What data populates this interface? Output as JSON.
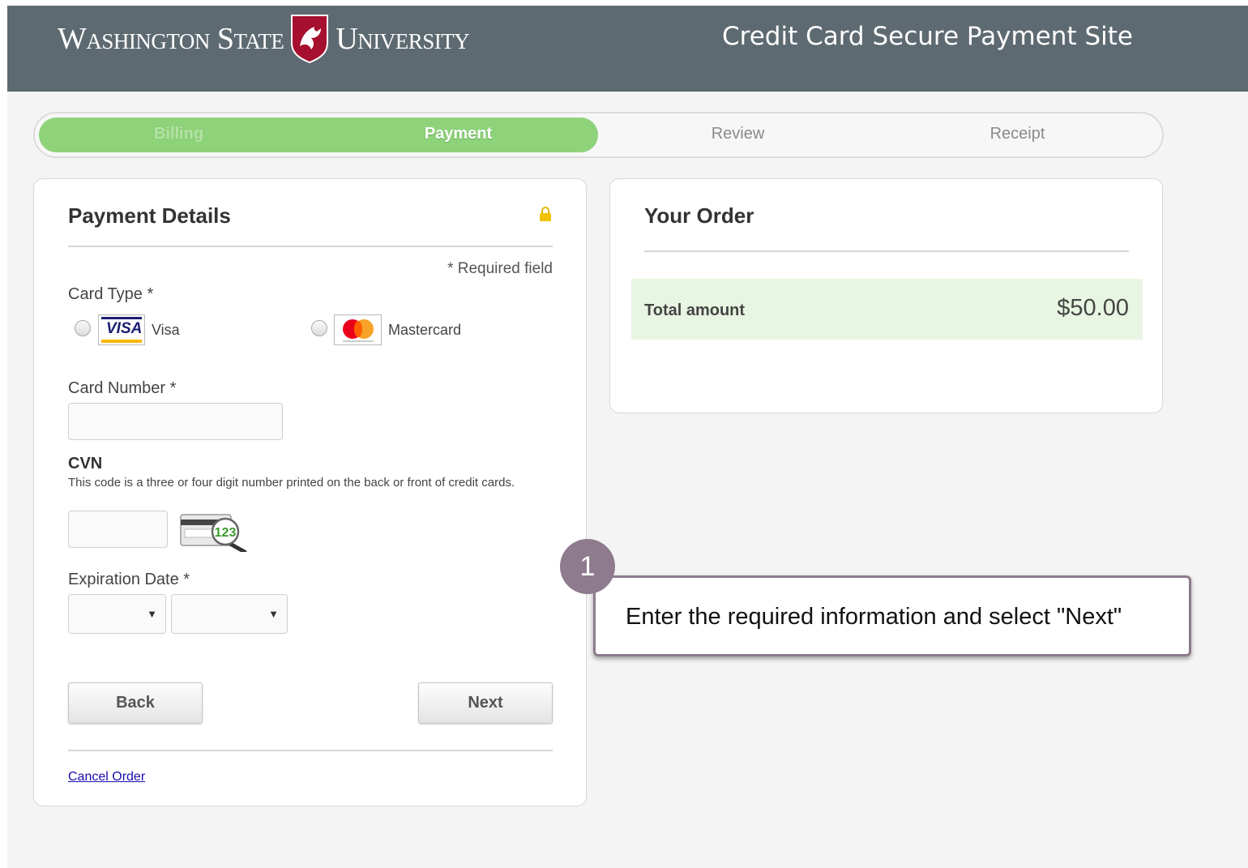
{
  "header": {
    "brand_left": "Washington State",
    "brand_right": "University",
    "site_title": "Credit Card Secure Payment Site"
  },
  "progress": {
    "steps": [
      {
        "label": "Billing",
        "state": "done"
      },
      {
        "label": "Payment",
        "state": "active"
      },
      {
        "label": "Review",
        "state": "todo"
      },
      {
        "label": "Receipt",
        "state": "todo"
      }
    ]
  },
  "payment": {
    "title": "Payment Details",
    "required_note": "* Required field",
    "card_type_label": "Card Type *",
    "options": [
      {
        "label": "Visa",
        "logo_text": "VISA",
        "selected": false
      },
      {
        "label": "Mastercard",
        "selected": false
      }
    ],
    "card_number_label": "Card Number *",
    "card_number_value": "",
    "cvn_label": "CVN",
    "cvn_hint": "This code is a three or four digit number printed on the back or front of credit cards.",
    "cvn_value": "",
    "cvn_image_text": "123",
    "expiration_label": "Expiration Date *",
    "exp_month": "",
    "exp_year": "",
    "back_label": "Back",
    "next_label": "Next",
    "cancel_label": "Cancel Order"
  },
  "order": {
    "title": "Your Order",
    "total_label": "Total amount",
    "total_amount": "$50.00"
  },
  "callout": {
    "number": "1",
    "text": "Enter the required information and select \"Next\""
  },
  "colors": {
    "header_bg": "#5e6a71",
    "progress_fill": "#8ed27a",
    "total_bg": "#e8f5e2",
    "callout": "#8e7b8e",
    "wsu_crimson": "#a60f2d"
  }
}
